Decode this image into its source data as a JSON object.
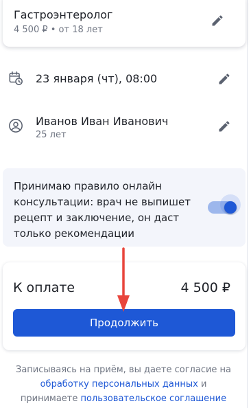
{
  "specialty": {
    "title": "Гастроэнтеролог",
    "subtitle": "4 500 ₽ • от 18 лет"
  },
  "appointment": {
    "datetime": "23 января (чт), 08:00"
  },
  "patient": {
    "name": "Иванов Иван Иванович",
    "age": "25 лет"
  },
  "rule": {
    "text": "Принимаю правило онлайн консультации: врач не выпишет рецепт и заключение, он даст только рекомендации",
    "toggle_on": true
  },
  "payment": {
    "label": "К оплате",
    "amount": "4 500 ₽",
    "continue_label": "Продолжить"
  },
  "consent": {
    "prefix": "Записываясь на приём, вы даете согласие на",
    "link_personal_data": "обработку персональных данных",
    "middle": "и",
    "accept": "принимаете",
    "link_user_agreement": "пользовательское соглашение"
  },
  "colors": {
    "accent": "#1e58d6",
    "annotation_arrow": "#e8453c",
    "icon": "#5b6270"
  },
  "icons": {
    "edit": "pencil-icon",
    "calendar": "calendar-clock-icon",
    "patient": "user-circle-icon"
  }
}
